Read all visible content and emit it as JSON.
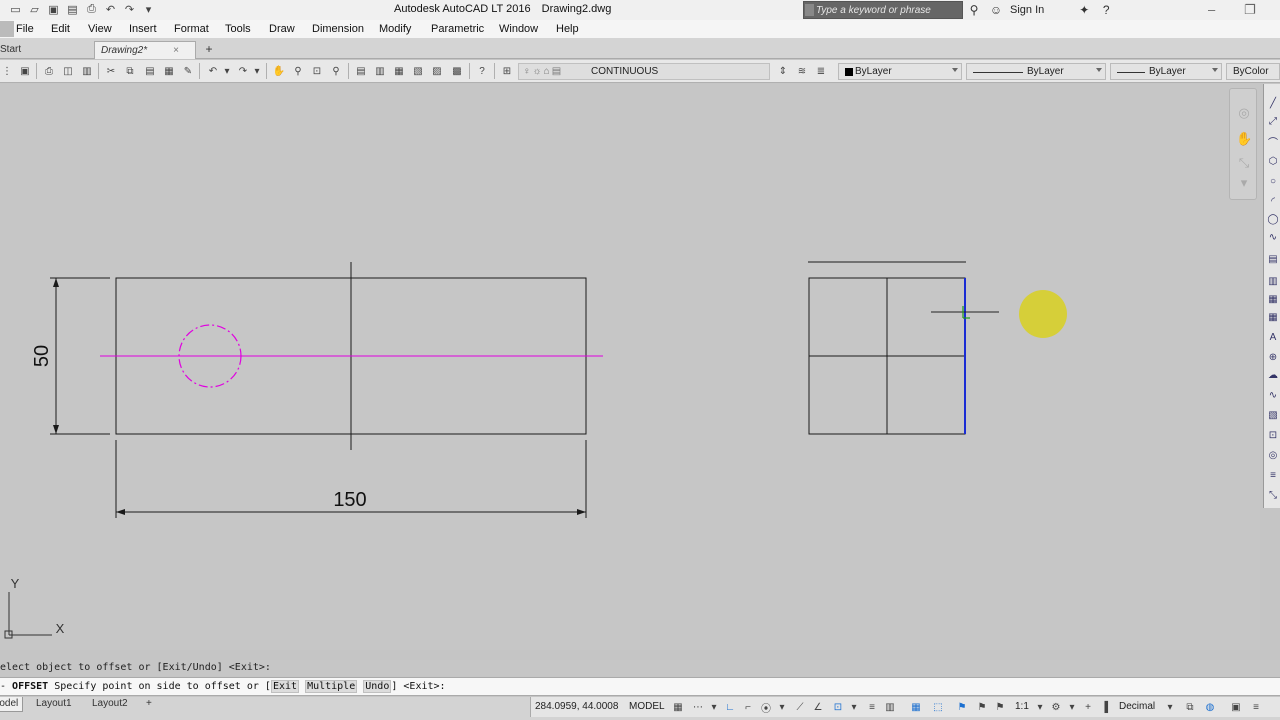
{
  "window": {
    "app_name": "Autodesk AutoCAD LT 2016",
    "document": "Drawing2.dwg",
    "search_placeholder": "Type a keyword or phrase",
    "sign_in": "Sign In"
  },
  "menu": [
    "File",
    "Edit",
    "View",
    "Insert",
    "Format",
    "Tools",
    "Draw",
    "Dimension",
    "Modify",
    "Parametric",
    "Window",
    "Help"
  ],
  "tabs": {
    "start": "Start",
    "drawing": "Drawing2*",
    "close_glyph": "×",
    "new_glyph": "+"
  },
  "properties": {
    "linetype_layer": "CONTINUOUS",
    "color": "ByLayer",
    "linetype": "ByLayer",
    "lineweight": "ByLayer",
    "plotstyle": "ByColor"
  },
  "drawing": {
    "dim_vertical": "50",
    "dim_horizontal": "150",
    "ucs_x": "X",
    "ucs_y": "Y",
    "center_line_color": "#e000e0",
    "selected_line_color": "#1a2cd4",
    "cursor_color": "#1a9a1a",
    "highlight_color": "#d8d020"
  },
  "command": {
    "history": "elect object to offset or [Exit/Undo] <Exit>:",
    "prefix": "- ",
    "keyword": "OFFSET",
    "prompt": " Specify point on side to offset or [",
    "opt1": "Exit",
    "opt2": "Multiple",
    "opt3": "Undo",
    "suffix": "] <Exit>:"
  },
  "status": {
    "layouts": [
      "Model",
      "Layout1",
      "Layout2"
    ],
    "coords": "284.0959, 44.0008",
    "model": "MODEL",
    "scale": "1:1",
    "units": "Decimal"
  }
}
